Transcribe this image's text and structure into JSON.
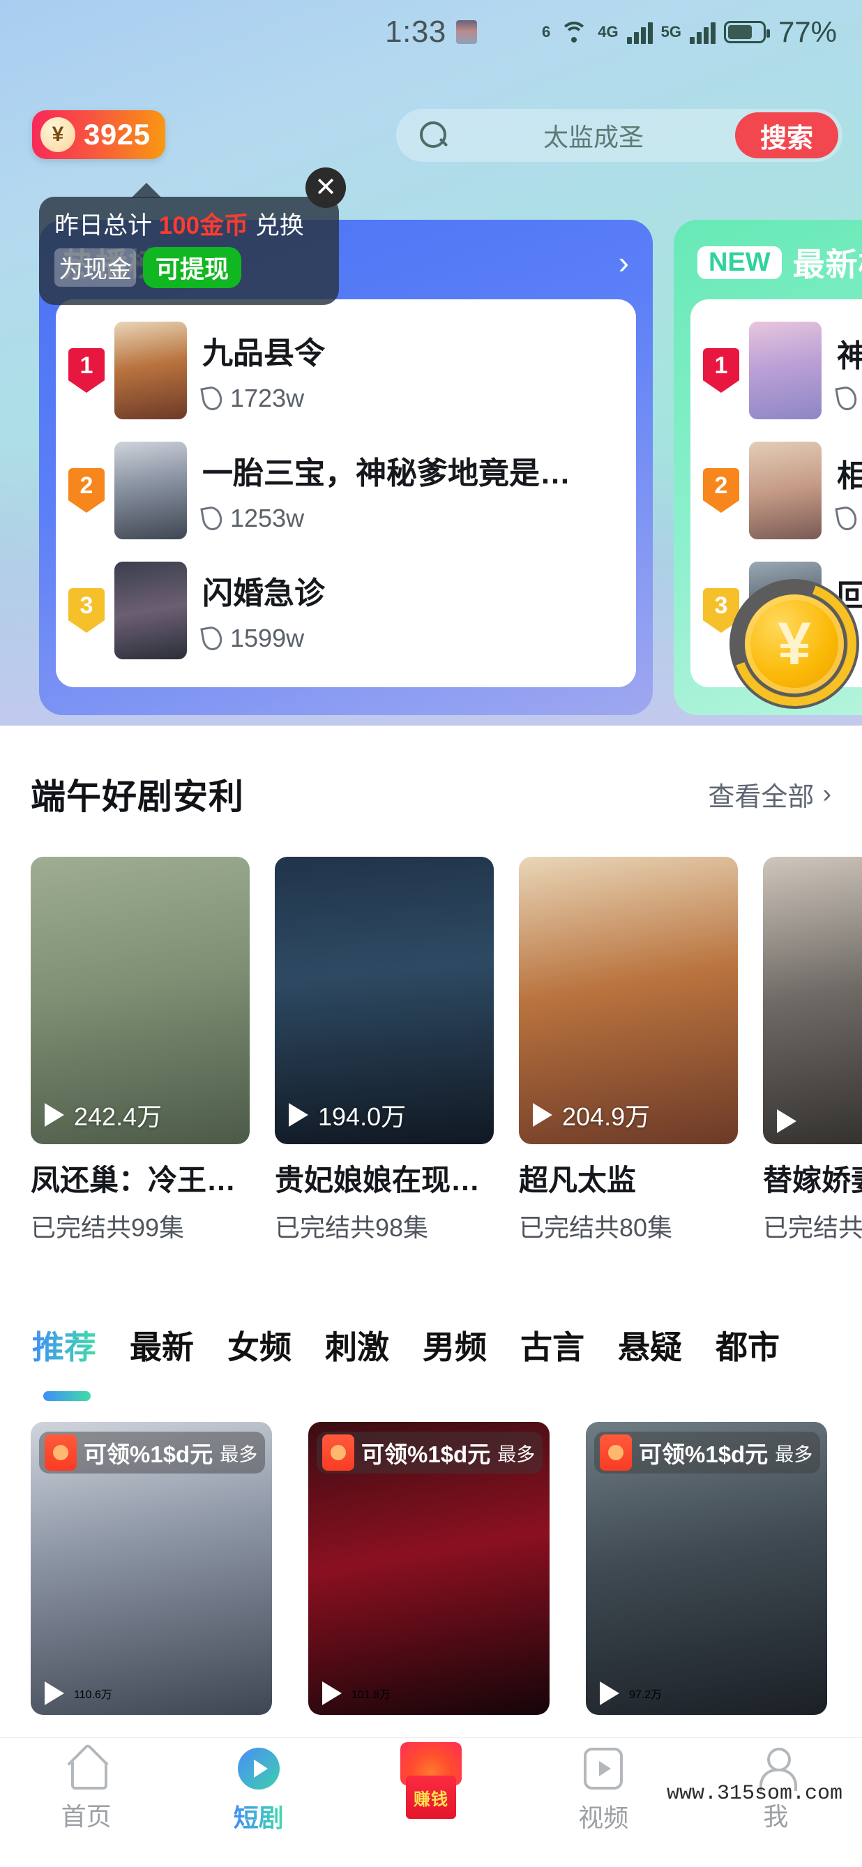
{
  "status_bar": {
    "time": "1:33",
    "wifi_label": "6",
    "net1_label": "4G",
    "net2_label": "5G",
    "battery_pct": "77%"
  },
  "header": {
    "coin_count": "3925",
    "coin_symbol": "¥",
    "search_placeholder": "太监成圣",
    "search_button": "搜索",
    "search_icon": "search-icon"
  },
  "tooltip": {
    "line1_prefix": "昨日总计 ",
    "line1_highlight": "100金币",
    "line1_suffix": " 兑换",
    "line2_text": "为现金",
    "line2_badge": "可提现",
    "close_icon": "✕"
  },
  "rank_cards": [
    {
      "title": "热播榜单",
      "badge": "",
      "chevron": "›",
      "items": [
        {
          "rank": "1",
          "title": "九品县令",
          "heat": "1723w",
          "thumb": "th-i"
        },
        {
          "rank": "2",
          "title": "一胎三宝，神秘爹地竟是…",
          "heat": "1253w",
          "thumb": "th-k"
        },
        {
          "rank": "3",
          "title": "闪婚急诊",
          "heat": "1599w",
          "thumb": "th-c"
        }
      ]
    },
    {
      "title": "最新榜",
      "badge": "NEW",
      "chevron": "›",
      "items": [
        {
          "rank": "1",
          "title": "神医",
          "heat": "",
          "thumb": "th-d"
        },
        {
          "rank": "2",
          "title": "相思",
          "heat": "",
          "thumb": "th-e"
        },
        {
          "rank": "3",
          "title": "回到",
          "heat": "",
          "thumb": "th-f"
        }
      ]
    }
  ],
  "float_coin": {
    "symbol": "¥"
  },
  "section": {
    "title": "端午好剧安利",
    "view_all": "查看全部",
    "view_all_chevron": "›"
  },
  "videos": [
    {
      "title": "凤还巢：冷王…",
      "sub": "已完结共99集",
      "plays": "242.4万",
      "thumb": "th-g"
    },
    {
      "title": "贵妃娘娘在现…",
      "sub": "已完结共98集",
      "plays": "194.0万",
      "thumb": "th-h"
    },
    {
      "title": "超凡太监",
      "sub": "已完结共80集",
      "plays": "204.9万",
      "thumb": "th-i"
    },
    {
      "title": "替嫁娇妻",
      "sub": "已完结共",
      "plays": "",
      "thumb": "th-m"
    }
  ],
  "tabs": [
    {
      "label": "推荐",
      "active": true
    },
    {
      "label": "最新",
      "active": false
    },
    {
      "label": "女频",
      "active": false
    },
    {
      "label": "刺激",
      "active": false
    },
    {
      "label": "男频",
      "active": false
    },
    {
      "label": "古言",
      "active": false
    },
    {
      "label": "悬疑",
      "active": false
    },
    {
      "label": "都市",
      "active": false
    }
  ],
  "grid": [
    {
      "badge_main": "可领%1$d元",
      "badge_sub": "最多",
      "plays": "110.6万",
      "thumb": "th-k"
    },
    {
      "badge_main": "可领%1$d元",
      "badge_sub": "最多",
      "plays": "101.8万",
      "thumb": "th-l"
    },
    {
      "badge_main": "可领%1$d元",
      "badge_sub": "最多",
      "plays": "97.2万",
      "thumb": "th-j"
    }
  ],
  "bottom_nav": [
    {
      "label": "首页",
      "icon": "home-icon",
      "active": false
    },
    {
      "label": "短剧",
      "icon": "play-circle-icon",
      "active": true
    },
    {
      "label": "赚钱",
      "icon": "gift-box-icon",
      "active": false
    },
    {
      "label": "视频",
      "icon": "video-icon",
      "active": false
    },
    {
      "label": "我",
      "icon": "person-icon",
      "active": false
    }
  ],
  "watermark": "www.315som.com",
  "colors": {
    "accent_red": "#f2474f",
    "accent_green": "#11b721",
    "coin_gradient_start": "#f8285a",
    "coin_gradient_end": "#f99a10",
    "rank1": "#e8173f",
    "rank2": "#f7861c",
    "rank3": "#f6c02a",
    "tab_active_start": "#3f8ef7",
    "tab_active_end": "#40dba9"
  }
}
